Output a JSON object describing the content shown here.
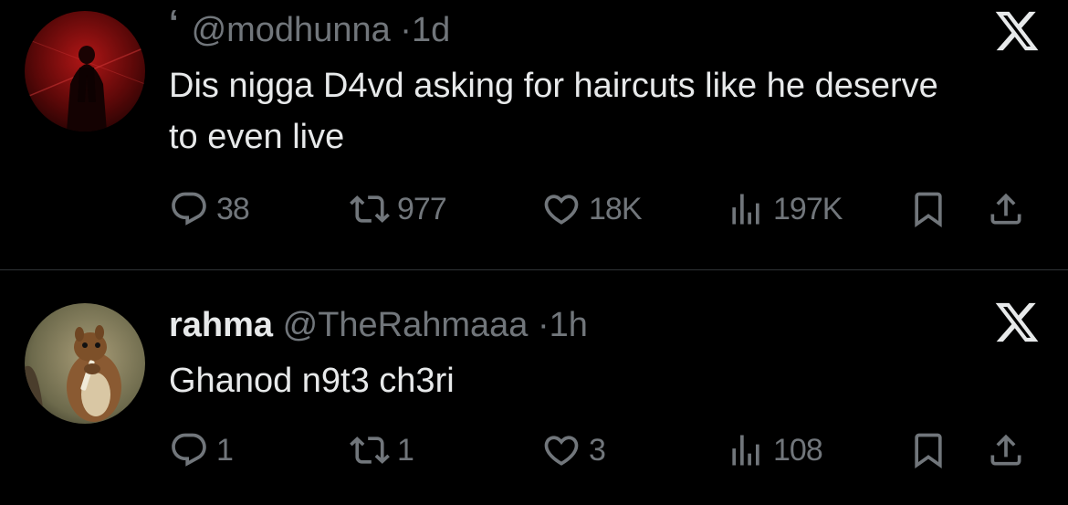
{
  "tweets": [
    {
      "quote_mark": "‘",
      "display_name": "",
      "handle": "@modhunna",
      "separator": "·",
      "time": "1d",
      "text": "Dis nigga D4vd asking for haircuts like he deserve to even live",
      "stats": {
        "replies": "38",
        "retweets": "977",
        "likes": "18K",
        "views": "197K"
      },
      "avatar": "red-dark-figure-avatar"
    },
    {
      "quote_mark": "",
      "display_name": "rahma",
      "handle": "@TheRahmaaa",
      "separator": "·",
      "time": "1h",
      "text": "Ghanod n9t3 ch3ri",
      "stats": {
        "replies": "1",
        "retweets": "1",
        "likes": "3",
        "views": "108"
      },
      "avatar": "squirrel-avatar"
    }
  ],
  "colors": {
    "background": "#000000",
    "text": "#e7e9ea",
    "secondary": "#71767b",
    "divider": "#2f3336"
  },
  "icons": [
    "reply-icon",
    "retweet-icon",
    "like-icon",
    "views-icon",
    "bookmark-icon",
    "share-icon",
    "x-logo-icon"
  ]
}
